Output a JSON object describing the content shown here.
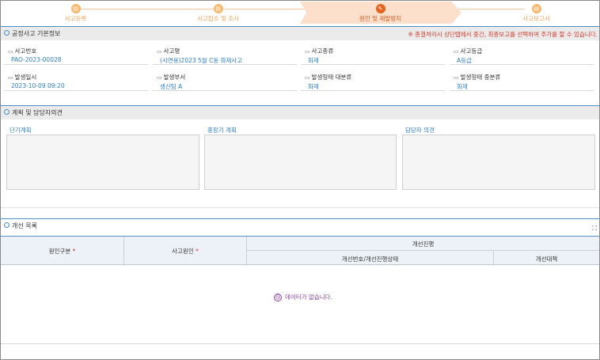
{
  "steps": [
    {
      "label": "사고등록",
      "icon": "doc-icon"
    },
    {
      "label": "사고접수 및 조사",
      "icon": "doc-icon"
    },
    {
      "label": "원인 및 재발방지",
      "icon": "edit-icon"
    },
    {
      "label": "사고보고서",
      "icon": "doc-icon"
    }
  ],
  "basic": {
    "title": "공정사고 기본정보",
    "notice": "※ 종결처리시 상단탭에서 중간, 최종보고를 선택하여 주가를 할 수 있습니다.",
    "fields": [
      {
        "label": "사고번호",
        "value": "PAO-2023-00028"
      },
      {
        "label": "사고명",
        "value": "(시연용)2023 5월 C동 화재사고"
      },
      {
        "label": "사고종류",
        "value": "화재"
      },
      {
        "label": "사고등급",
        "value": "A등급"
      },
      {
        "label": "발생일시",
        "value": "2023-10-09 09:20"
      },
      {
        "label": "발생부서",
        "value": "생산팀 A"
      },
      {
        "label": "발생형태 대분류",
        "value": "화재"
      },
      {
        "label": "발생형태 중분류",
        "value": "화재"
      }
    ]
  },
  "plan": {
    "title": "계획 및 담당자의견",
    "short_label": "단기계획",
    "mid_label": "중장기 계획",
    "owner_label": "담당자 의견"
  },
  "improve": {
    "title": "개선 목록",
    "col_cause_type": "원인구분",
    "col_cause": "사고원인",
    "col_progress": "개선진행",
    "col_progress_sub1": "개선번호/개선진행상태",
    "col_progress_sub2": "개선대책",
    "required_mark": "*",
    "empty_text": "데이터가 없습니다.",
    "empty_face": "☹",
    "expand_icon": "⛶"
  },
  "colors": {
    "accent": "#4a90c8",
    "step": "#f2a25a",
    "active_step": "#e0571a",
    "link": "#2b7fd0",
    "notice": "#d93a2a"
  }
}
